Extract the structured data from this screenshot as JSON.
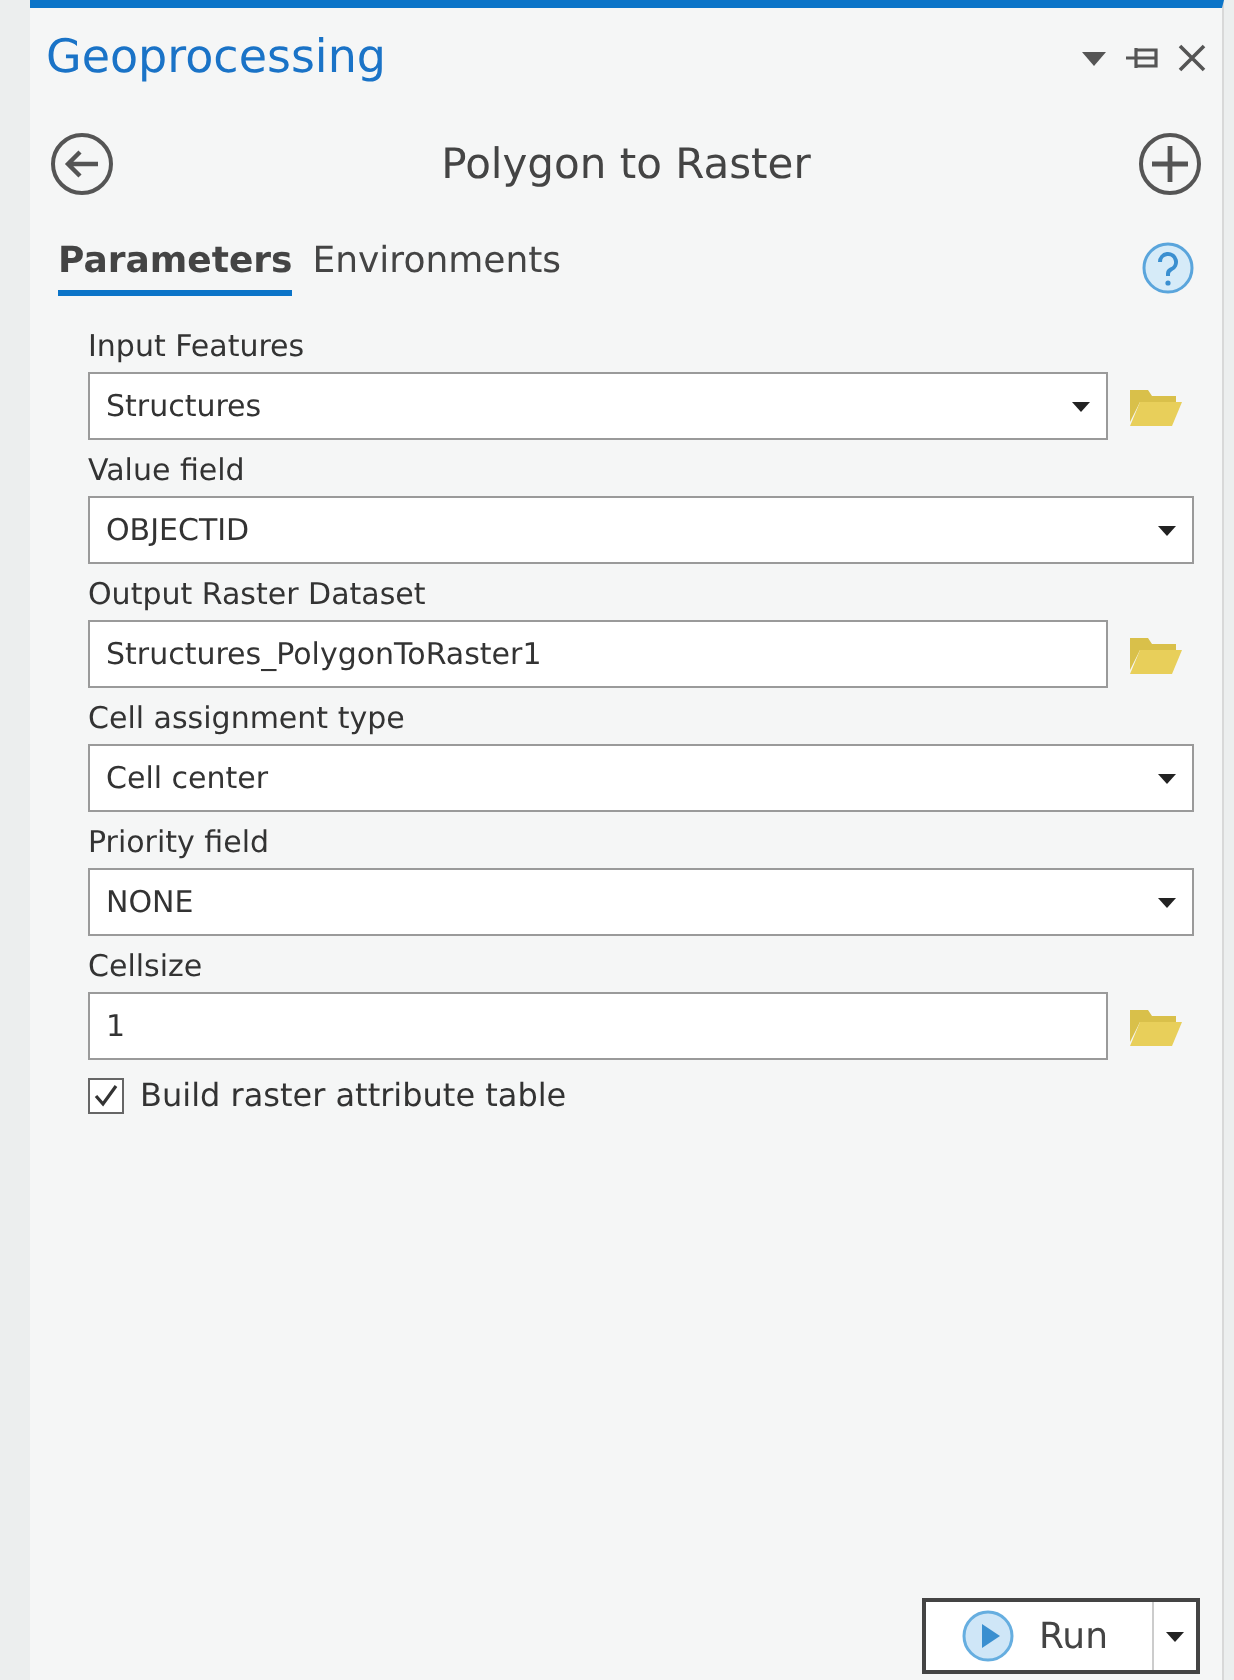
{
  "pane": {
    "title": "Geoprocessing"
  },
  "tool": {
    "title": "Polygon to Raster"
  },
  "tabs": [
    {
      "label": "Parameters",
      "selected": true
    },
    {
      "label": "Environments",
      "selected": false
    }
  ],
  "parameters": [
    {
      "label": "Input Features",
      "kind": "dropdown",
      "value": "Structures",
      "browse": true
    },
    {
      "label": "Value field",
      "kind": "dropdown",
      "value": "OBJECTID",
      "browse": false
    },
    {
      "label": "Output Raster Dataset",
      "kind": "text",
      "value": "Structures_PolygonToRaster1",
      "browse": true
    },
    {
      "label": "Cell assignment type",
      "kind": "dropdown",
      "value": "Cell center",
      "browse": false
    },
    {
      "label": "Priority field",
      "kind": "dropdown",
      "value": "NONE",
      "browse": false
    },
    {
      "label": "Cellsize",
      "kind": "text",
      "value": "1",
      "browse": true
    }
  ],
  "options": [
    {
      "label": "Build raster attribute table",
      "checked": true
    }
  ],
  "run_button": {
    "label": "Run"
  }
}
